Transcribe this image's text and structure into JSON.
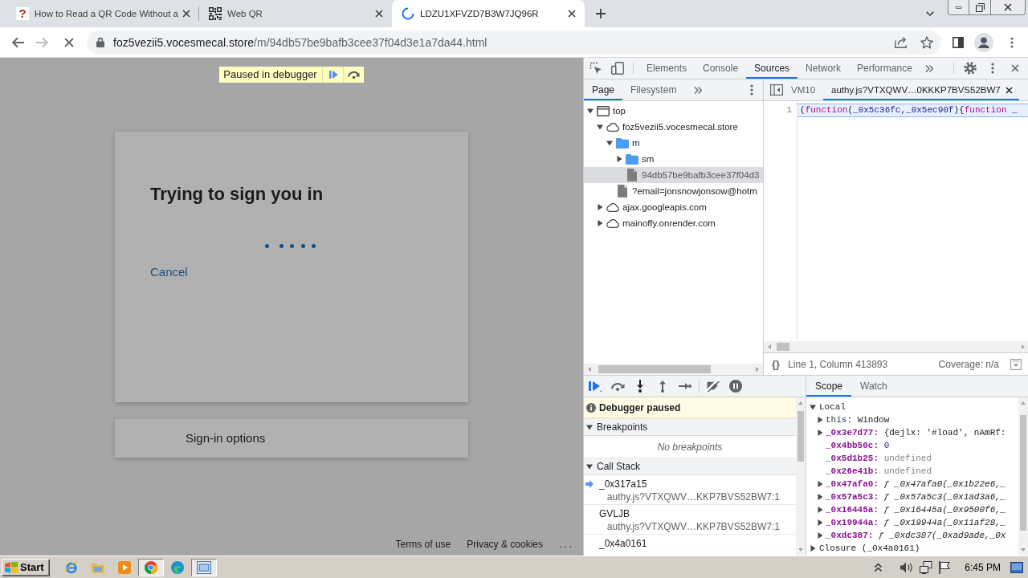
{
  "browser": {
    "tabs": [
      {
        "kind": "help",
        "favicon": "?",
        "title": "How to Read a QR Code Without a",
        "selected": false
      },
      {
        "kind": "qr",
        "title": "Web QR",
        "selected": false
      },
      {
        "kind": "loading",
        "title": "LDZU1XFVZD7B3W7JQ96R",
        "selected": true
      }
    ],
    "toolbar": {
      "forward_disabled": true,
      "loading": true
    },
    "address": {
      "host": "foz5vezii5.vocesmecal.store",
      "path": "/m/94db57be9bafb3cee37f04d3e1a7da44.html"
    }
  },
  "page": {
    "paused_banner": "Paused in debugger",
    "card": {
      "title": "Trying to sign you in",
      "link": "Cancel"
    },
    "options": "Sign-in options",
    "footer": [
      {
        "kind": "link",
        "label": "Terms of use"
      },
      {
        "kind": "link",
        "label": "Privacy & cookies"
      },
      {
        "kind": "more",
        "label": "..."
      }
    ]
  },
  "devtools": {
    "tabs": [
      {
        "label": "Elements",
        "selected": false
      },
      {
        "label": "Console",
        "selected": false
      },
      {
        "label": "Sources",
        "selected": true
      },
      {
        "label": "Network",
        "selected": false
      },
      {
        "label": "Performance",
        "selected": false
      }
    ],
    "navigator": {
      "tabs": [
        {
          "label": "Page",
          "selected": true
        },
        {
          "label": "Filesystem",
          "selected": false
        }
      ],
      "tree": [
        {
          "kind": "frame",
          "label": "top",
          "expanded": true,
          "selected": false,
          "children": [
            {
              "kind": "domain",
              "label": "foz5vezii5.vocesmecal.store",
              "expanded": true,
              "selected": false,
              "children": [
                {
                  "kind": "folder",
                  "label": "m",
                  "expanded": true,
                  "selected": false,
                  "children": [
                    {
                      "kind": "folder",
                      "label": "sm",
                      "expanded": false,
                      "selected": false
                    },
                    {
                      "kind": "file",
                      "label": "94db57be9bafb3cee37f04d3",
                      "selected": true
                    }
                  ]
                },
                {
                  "kind": "file",
                  "label": "?email=jonsnowjonsow@hotm",
                  "selected": false
                }
              ]
            },
            {
              "kind": "domain",
              "label": "ajax.googleapis.com",
              "expanded": false,
              "selected": false
            },
            {
              "kind": "domain",
              "label": "mainoffy.onrender.com",
              "expanded": false,
              "selected": false
            }
          ]
        }
      ]
    },
    "editor": {
      "tabs": [
        {
          "label": "VM10",
          "selected": false
        },
        {
          "label": "authy.js?VTXQWV…0KKKP7BVS52BW7",
          "selected": true
        }
      ],
      "lines": [
        {
          "number": "1",
          "current": true,
          "tokens": [
            {
              "kind": "punct",
              "text": "("
            },
            {
              "kind": "keyword",
              "text": "function"
            },
            {
              "kind": "punct",
              "text": "("
            },
            {
              "kind": "param",
              "text": "_0x5c36fc"
            },
            {
              "kind": "punct",
              "text": ","
            },
            {
              "kind": "param",
              "text": "_0x5ec90f"
            },
            {
              "kind": "punct",
              "text": "){"
            },
            {
              "kind": "keyword",
              "text": "function"
            },
            {
              "kind": "param",
              "text": " _"
            }
          ]
        }
      ],
      "status": {
        "format": "{}",
        "position": "Line 1, Column 413893",
        "coverage": "Coverage: n/a"
      }
    },
    "debugger": {
      "message": "Debugger paused",
      "breakpoints": {
        "title": "Breakpoints",
        "expanded": true,
        "empty": "No breakpoints"
      },
      "call_stack": {
        "title": "Call Stack",
        "expanded": true,
        "frames": [
          {
            "function": "_0x317a15",
            "location": "authy.js?VTXQWV…KKP7BVS52BW7:1",
            "current": true
          },
          {
            "function": "GVLJB",
            "location": "authy.js?VTXQWV…KKP7BVS52BW7:1",
            "current": false
          },
          {
            "function": "_0x4a0161",
            "current": false
          }
        ]
      }
    },
    "sidebar": {
      "tabs": [
        {
          "label": "Scope",
          "selected": true
        },
        {
          "label": "Watch",
          "selected": false
        }
      ],
      "scope": [
        {
          "label": "Local",
          "expanded": true,
          "children": [
            {
              "name": "this:",
              "kind": "receiver",
              "value": "Window",
              "expanded": false
            },
            {
              "name": "_0x3e7d77:",
              "kind": "object",
              "value": "{dejlx: '#load', nAmRf:",
              "expanded": false
            },
            {
              "name": "_0x4bb50c:",
              "kind": "number",
              "value": "0"
            },
            {
              "name": "_0x5d1b25:",
              "kind": "undefined",
              "value": "undefined"
            },
            {
              "name": "_0x26e41b:",
              "kind": "undefined",
              "value": "undefined"
            },
            {
              "name": "_0x47afa0:",
              "kind": "function",
              "value": "ƒ _0x47afa0(_0x1b22e6,_",
              "expanded": false
            },
            {
              "name": "_0x57a5c3:",
              "kind": "function",
              "value": "ƒ _0x57a5c3(_0x1ad3a6,_",
              "expanded": false
            },
            {
              "name": "_0x16445a:",
              "kind": "function",
              "value": "ƒ _0x16445a(_0x9500f6,_",
              "expanded": false
            },
            {
              "name": "_0x19944a:",
              "kind": "function",
              "value": "ƒ _0x19944a(_0x11af28,_",
              "expanded": false
            },
            {
              "name": "_0xdc387:",
              "kind": "function",
              "value": "ƒ _0xdc387(_0xad9ade,_0x",
              "expanded": false
            }
          ]
        },
        {
          "label": "Closure (_0x4a0161)",
          "expanded": false
        }
      ]
    }
  },
  "taskbar": {
    "start": "Start",
    "apps": [
      {
        "kind": "ie",
        "active": false
      },
      {
        "kind": "explorer",
        "active": false
      },
      {
        "kind": "media",
        "active": false
      },
      {
        "kind": "chrome",
        "active": true
      },
      {
        "kind": "edge",
        "active": false
      },
      {
        "kind": "window",
        "active": true
      }
    ],
    "clock": "6:45 PM"
  }
}
